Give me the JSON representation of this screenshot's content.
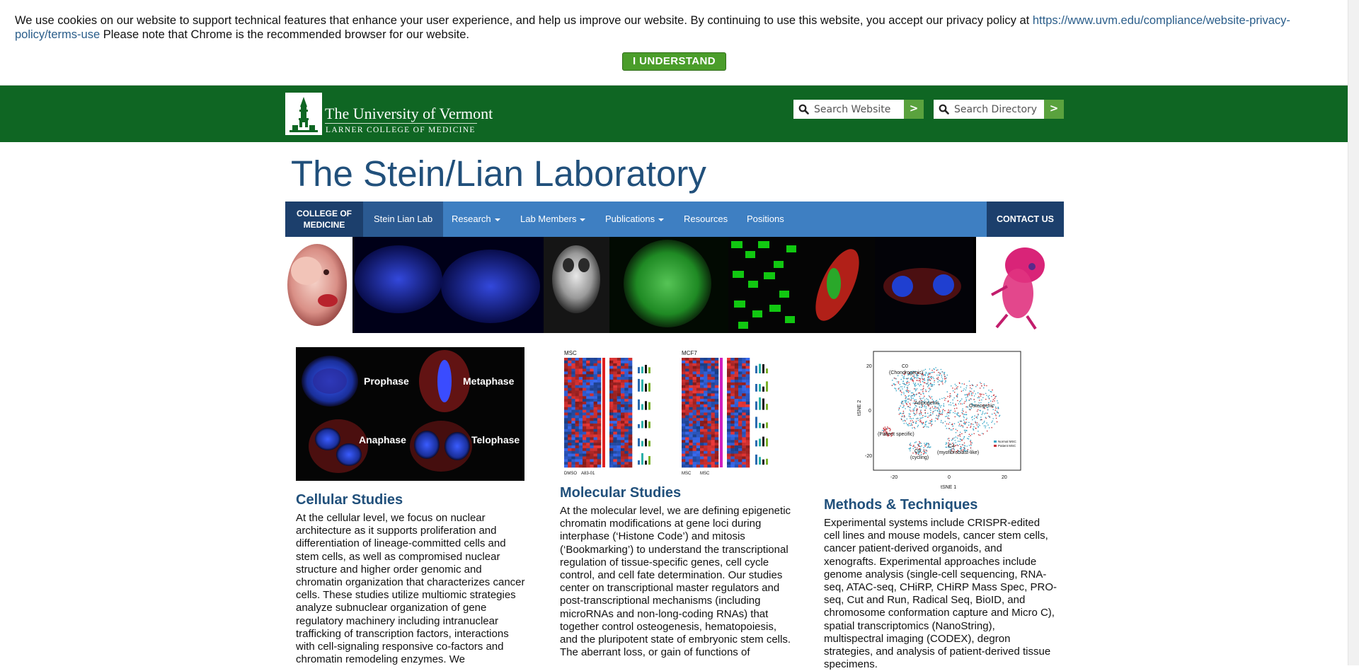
{
  "cookie_banner": {
    "text": "We use cookies on our website to support technical features that enhance your user experience, and help us improve our website. By continuing to use this website, you accept our privacy policy at",
    "link": "https://www.uvm.edu/compliance/website-privacy-policy/terms-use",
    "text_after": " Please note that Chrome is the recommended browser for our website.",
    "button": "I UNDERSTAND"
  },
  "header": {
    "logo_title": "The University of Vermont",
    "logo_subtitle": "LARNER COLLEGE OF MEDICINE",
    "search_website": {
      "placeholder": "Search Website",
      "button": ">"
    },
    "search_directory": {
      "placeholder": "Search Directory",
      "button": ">"
    }
  },
  "site_title": "The Stein/Lian Laboratory",
  "nav": {
    "college": "COLLEGE OF MEDICINE",
    "home": "Stein Lian Lab",
    "items": [
      "Research",
      "Lab Members",
      "Publications",
      "Resources",
      "Positions"
    ],
    "contact": "CONTACT US"
  },
  "figures": {
    "mitosis_labels": [
      "Prophase",
      "Metaphase",
      "Anaphase",
      "Telophase"
    ],
    "heatmap_labels": [
      "MSC",
      "MCF7",
      "DMSO",
      "A83-01",
      "MSC",
      "MSC"
    ],
    "tsne": {
      "cluster_labels": [
        "C0",
        "(Chondrogenic)",
        "Adipogenic",
        "Osteogenic",
        "(Patient specific)",
        "C5",
        "(cycling)",
        "C4",
        "(myofibroblast-like)"
      ],
      "x_axis_label": "tSNE 1",
      "y_axis_label": "tSNE 2",
      "x_ticks": [
        "-20",
        "0",
        "20"
      ],
      "y_ticks": [
        "20",
        "0",
        "-20"
      ],
      "legend": [
        "Normal MSC",
        "Patient MSC"
      ]
    }
  },
  "columns": [
    {
      "title": "Cellular Studies",
      "text": "At the cellular level, we focus on nuclear architecture as it supports proliferation and differentiation of lineage-committed cells and stem cells, as well as compromised nuclear structure and higher order genomic and chromatin organization that characterizes cancer cells. These studies utilize multiomic strategies analyze subnuclear organization of gene regulatory machinery including intranuclear trafficking of transcription factors, interactions with cell-signaling responsive co-factors and chromatin remodeling enzymes. We"
    },
    {
      "title": "Molecular Studies",
      "text": "At the molecular level, we are defining epigenetic chromatin modifications at gene loci during interphase (‘Histone Code’) and mitosis (‘Bookmarking’) to understand the transcriptional regulation of tissue-specific genes, cell cycle control, and cell fate determination. Our studies center on transcriptional master regulators and post-transcriptional mechanisms (including microRNAs and non-long-coding RNAs) that together control osteogenesis, hematopoiesis, and the pluripotent state of embryonic stem cells. The aberrant loss, or gain of functions of"
    },
    {
      "title": "Methods & Techniques",
      "text": "Experimental systems include CRISPR-edited cell lines and mouse models, cancer stem cells, cancer patient-derived organoids, and xenografts. Experimental approaches include genome analysis (single-cell sequencing, RNA-seq, ATAC-seq, CHiRP, CHiRP Mass Spec, PRO-seq, Cut and Run, Radical Seq, BioID, and chromosome conformation capture and Micro C), spatial transcriptomics (NanoString), multispectral imaging (CODEX), degron strategies, and analysis of patient-derived tissue specimens."
    }
  ]
}
